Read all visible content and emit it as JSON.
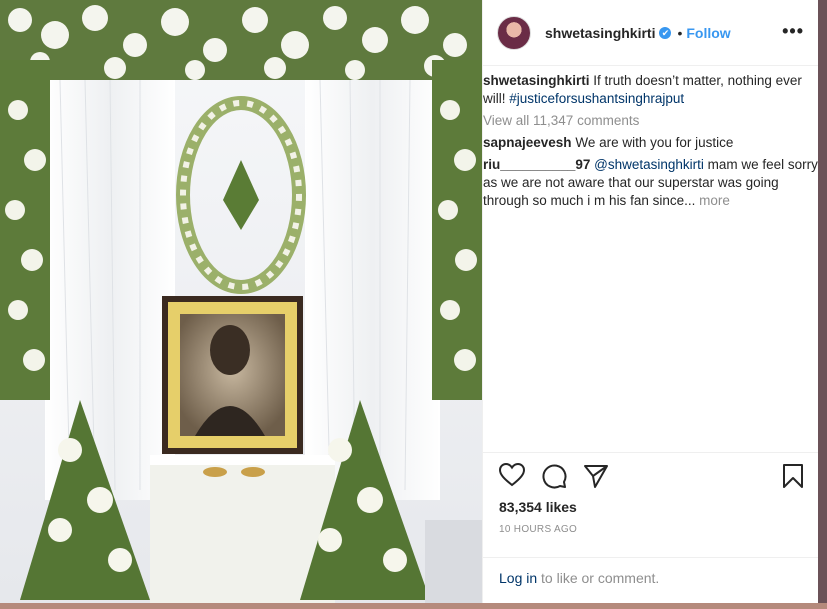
{
  "post": {
    "username": "shwetasinghkirti",
    "verified_badge": "✔",
    "separator": "•",
    "follow_label": "Follow",
    "options_icon": "•••"
  },
  "caption": {
    "user": "shwetasinghkirti",
    "text": "If truth doesn’t matter, nothing ever will!",
    "hashtag": "#justiceforsushantsinghrajput"
  },
  "view_all_comments": "View all 11,347 comments",
  "comments": [
    {
      "user": "sapnajeevesh",
      "text": "We are with you for justice"
    },
    {
      "user": "riu__________97",
      "mention": "@shwetasinghkirti",
      "text": "mam we feel sorry as we are not aware that our superstar was going through so much i m his fan since...",
      "more": "more"
    }
  ],
  "actions": {
    "icons": [
      "heart-icon",
      "comment-icon",
      "share-icon",
      "bookmark-icon"
    ]
  },
  "likes": "83,354 likes",
  "timestamp": "10 HOURS AGO",
  "login": {
    "link": "Log in",
    "rest": "to like or comment."
  },
  "colors": {
    "link_blue": "#3897f0",
    "tag_blue": "#003569",
    "muted": "#8e8e8e",
    "text": "#262626"
  }
}
